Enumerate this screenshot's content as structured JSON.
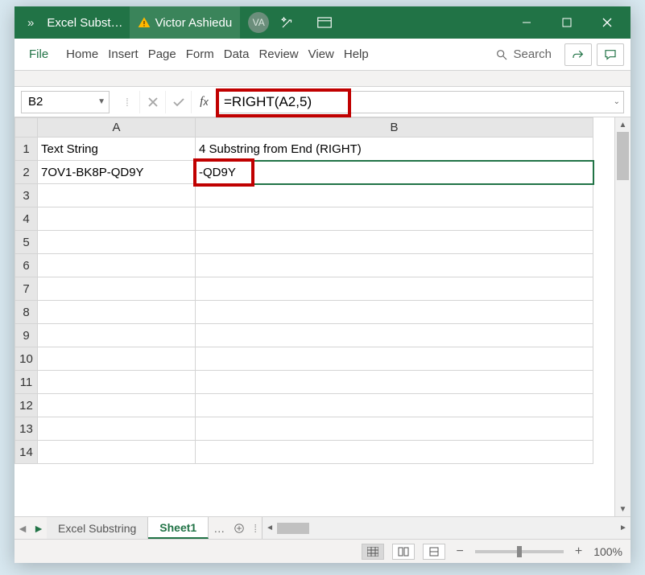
{
  "titlebar": {
    "more": "»",
    "doc_name": "Excel Subst…",
    "user_name": "Victor Ashiedu",
    "user_initials": "VA"
  },
  "menubar": {
    "items": [
      "File",
      "Home",
      "Insert",
      "Page",
      "Form",
      "Data",
      "Review",
      "View",
      "Help"
    ],
    "search": "Search"
  },
  "formula_bar": {
    "name_box": "B2",
    "formula": "=RIGHT(A2,5)"
  },
  "columns": [
    "A",
    "B"
  ],
  "rows": [
    "1",
    "2",
    "3",
    "4",
    "5",
    "6",
    "7",
    "8",
    "9",
    "10",
    "11",
    "12",
    "13",
    "14"
  ],
  "cells": {
    "A1": "Text String",
    "B1": "4 Substring from End (RIGHT)",
    "A2": "7OV1-BK8P-QD9Y",
    "B2": "-QD9Y"
  },
  "tabs": {
    "inactive": "Excel Substring",
    "active": "Sheet1",
    "ellipsis": "…"
  },
  "status": {
    "zoom": "100%"
  },
  "chart_data": {
    "type": "table",
    "headers": [
      "Text String",
      "4 Substring from End (RIGHT)"
    ],
    "rows": [
      [
        "7OV1-BK8P-QD9Y",
        "-QD9Y"
      ]
    ],
    "formula_applied": "=RIGHT(A2,5)",
    "selected_cell": "B2"
  }
}
